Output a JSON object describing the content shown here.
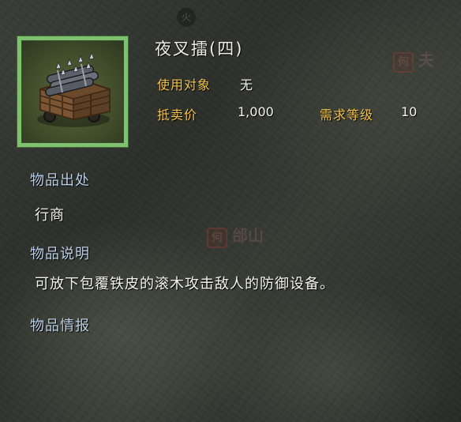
{
  "item": {
    "name": "夜叉擂(四)",
    "target_label": "使用对象",
    "target_value": "无",
    "sell_label": "抵卖价",
    "sell_value": "1,000",
    "level_label": "需求等级",
    "level_value": "10"
  },
  "sections": {
    "source_title": "物品出处",
    "source_value": "行商",
    "desc_title": "物品说明",
    "desc_value": "可放下包覆铁皮的滚木攻击敌人的防御设备。",
    "info_title": "物品情报"
  },
  "background": {
    "marker_top_right_icon": "何",
    "marker_top_right_text": "夫",
    "marker_mid_icon": "何",
    "marker_mid_text": "邰山",
    "marker_circle_text": "火"
  },
  "icons": {
    "item_icon": "siege-trap-icon"
  },
  "colors": {
    "label_gold": "#f0c24a",
    "section_blue": "#b9cfe6",
    "frame_green": "#7fc071",
    "text_white": "#f4f2ec"
  }
}
